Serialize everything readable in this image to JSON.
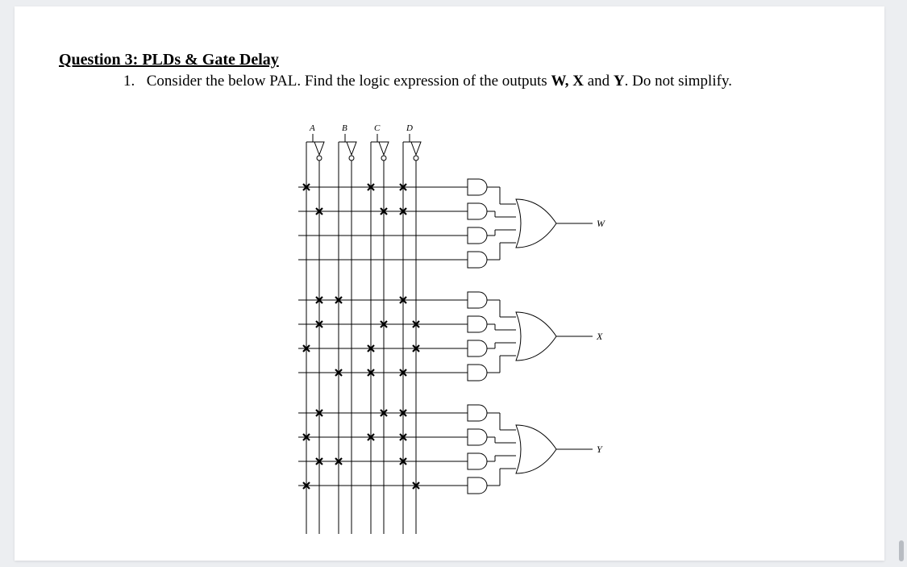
{
  "title": "Question 3: PLDs & Gate Delay",
  "item_number": "1.",
  "item_text_1": "Consider the below PAL. Find the logic expression of the outputs ",
  "item_bold": "W, X",
  "item_text_2": " and ",
  "item_bold2": "Y",
  "item_text_3": ". Do not simplify.",
  "inputs": {
    "A": "A",
    "B": "B",
    "C": "C",
    "D": "D"
  },
  "outputs": {
    "W": "W",
    "X": "X",
    "Y": "Y"
  },
  "chart_data": {
    "type": "table",
    "title": "PAL fuse map (X marks a connection)",
    "input_lines_order": [
      "A",
      "A'",
      "B",
      "B'",
      "C",
      "C'",
      "D",
      "D'"
    ],
    "gates": [
      {
        "output": "W",
        "and_terms": [
          {
            "idx": 1,
            "connections": [
              "A",
              "C",
              "D"
            ]
          },
          {
            "idx": 2,
            "connections": [
              "A'",
              "C'",
              "D"
            ]
          },
          {
            "idx": 3,
            "connections": []
          },
          {
            "idx": 4,
            "connections": []
          }
        ]
      },
      {
        "output": "X",
        "and_terms": [
          {
            "idx": 5,
            "connections": [
              "A'",
              "B",
              "D"
            ]
          },
          {
            "idx": 6,
            "connections": [
              "A'",
              "C'",
              "D'"
            ]
          },
          {
            "idx": 7,
            "connections": [
              "A",
              "C",
              "D'"
            ]
          },
          {
            "idx": 8,
            "connections": [
              "B",
              "C",
              "D"
            ]
          }
        ]
      },
      {
        "output": "Y",
        "and_terms": [
          {
            "idx": 9,
            "connections": [
              "A'",
              "C'",
              "D"
            ]
          },
          {
            "idx": 10,
            "connections": [
              "A",
              "C",
              "D"
            ]
          },
          {
            "idx": 11,
            "connections": [
              "A'",
              "B",
              "D"
            ]
          },
          {
            "idx": 12,
            "connections": [
              "A",
              "D'"
            ]
          }
        ]
      }
    ]
  }
}
